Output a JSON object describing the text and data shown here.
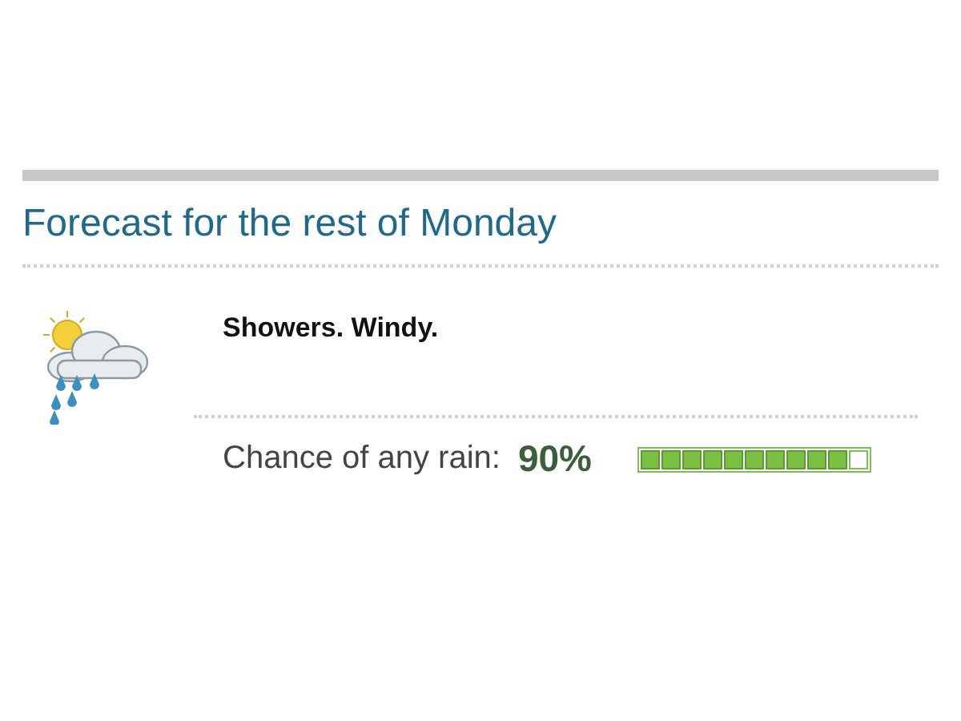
{
  "heading": "Forecast for the rest of Monday",
  "summary": "Showers. Windy.",
  "rain": {
    "label": "Chance of any rain:",
    "value": "90%",
    "level": 0.9
  }
}
